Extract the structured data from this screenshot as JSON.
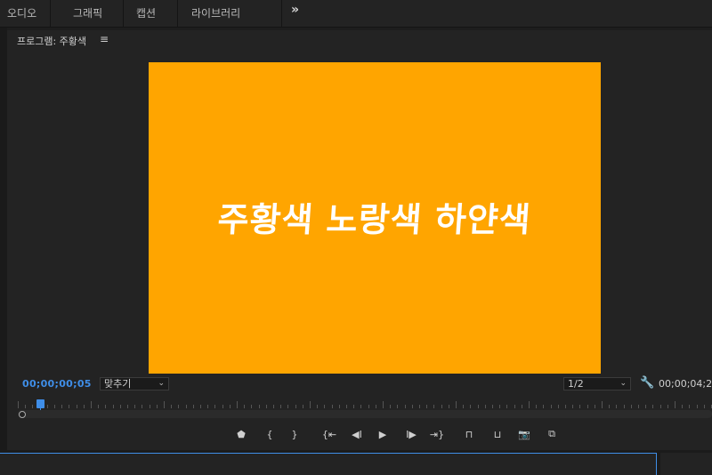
{
  "workspace_tabs": [
    "오디오",
    "그래픽",
    "캡션",
    "라이브러리"
  ],
  "workspace_more": "»",
  "panel": {
    "title": "프로그램: 주황색",
    "menu_icon": "≡"
  },
  "frame": {
    "text": "주황색 노랑색 하얀색",
    "background": "#ffa500",
    "text_color": "#ffffff"
  },
  "playback": {
    "current_timecode": "00;00;00;05",
    "zoom_select": "맞추기",
    "resolution_select": "1/2",
    "duration": "00;00;04;2",
    "accent_color": "#3f8ee8"
  },
  "transport_buttons": [
    {
      "name": "add-marker-icon",
      "glyph": "⬟"
    },
    {
      "name": "mark-in-icon",
      "glyph": "{"
    },
    {
      "name": "mark-out-icon",
      "glyph": "}"
    },
    {
      "name": "go-to-in-icon",
      "glyph": "{⇤"
    },
    {
      "name": "step-back-icon",
      "glyph": "◀I"
    },
    {
      "name": "play-icon",
      "glyph": "▶"
    },
    {
      "name": "step-forward-icon",
      "glyph": "I▶"
    },
    {
      "name": "go-to-out-icon",
      "glyph": "⇥}"
    },
    {
      "name": "lift-icon",
      "glyph": "⊓"
    },
    {
      "name": "extract-icon",
      "glyph": "⊔"
    },
    {
      "name": "export-frame-icon",
      "glyph": "📷"
    },
    {
      "name": "comparison-view-icon",
      "glyph": "⧉"
    }
  ]
}
